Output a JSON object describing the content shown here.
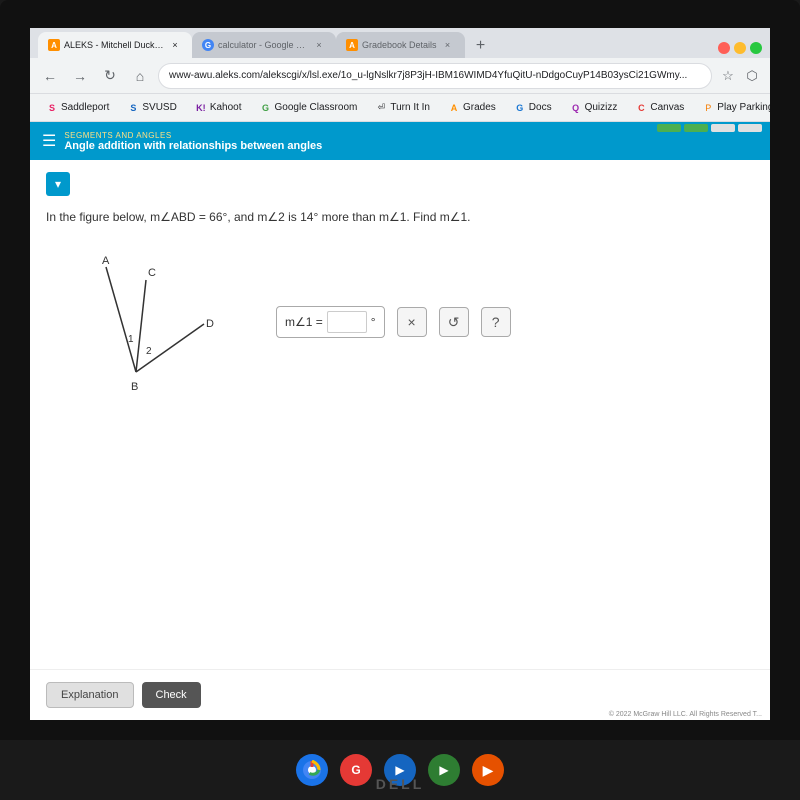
{
  "browser": {
    "tabs": [
      {
        "id": "aleks",
        "label": "ALEKS - Mitchell Duck - Learn",
        "favicon": "A",
        "active": true
      },
      {
        "id": "calculator",
        "label": "calculator - Google Search",
        "favicon": "G",
        "active": false
      },
      {
        "id": "gradebook",
        "label": "Gradebook Details",
        "favicon": "A",
        "active": false
      }
    ],
    "address": "www-awu.aleks.com/alekscgi/x/lsl.exe/1o_u-lgNslkr7j8P3jH-IBM16WIMD4YfuQitU-nDdgoCuyP14B03ysCi21GWmy...",
    "bookmarks": [
      {
        "label": "Saddlport",
        "icon": "S"
      },
      {
        "label": "SVUSD",
        "icon": "S"
      },
      {
        "label": "Kahoot",
        "icon": "K"
      },
      {
        "label": "Google Classroom",
        "icon": "G"
      },
      {
        "label": "Turn It In",
        "icon": "⏎"
      },
      {
        "label": "Grades",
        "icon": "A"
      },
      {
        "label": "Docs",
        "icon": "G"
      },
      {
        "label": "Quizizz",
        "icon": "Q"
      },
      {
        "label": "Canvas",
        "icon": "C"
      },
      {
        "label": "Play Parking Tight...",
        "icon": "P"
      }
    ]
  },
  "aleks": {
    "section_badge": "SEGMENTS AND ANGLES",
    "section_name": "Angle addition with relationships between angles",
    "problem_text": "In the figure below, m∠ABD = 66°, and m∠2 is 14° more than m∠1. Find m∠1.",
    "answer_label": "m∠1 =",
    "answer_placeholder": "",
    "degree_symbol": "°",
    "btn_explanation": "Explanation",
    "btn_check": "Check",
    "expand_icon": "▾"
  },
  "taskbar": {
    "icons": [
      "🔵",
      "🔴",
      "🟡",
      "▶",
      "📁",
      "▶",
      "🟠"
    ],
    "dell_logo": "DELL"
  },
  "copyright": "© 2022 McGraw Hill LLC. All Rights Reserved  T...",
  "progress": {
    "segments": [
      "#4caf50",
      "#4caf50",
      "#e0e0e0",
      "#e0e0e0"
    ]
  }
}
